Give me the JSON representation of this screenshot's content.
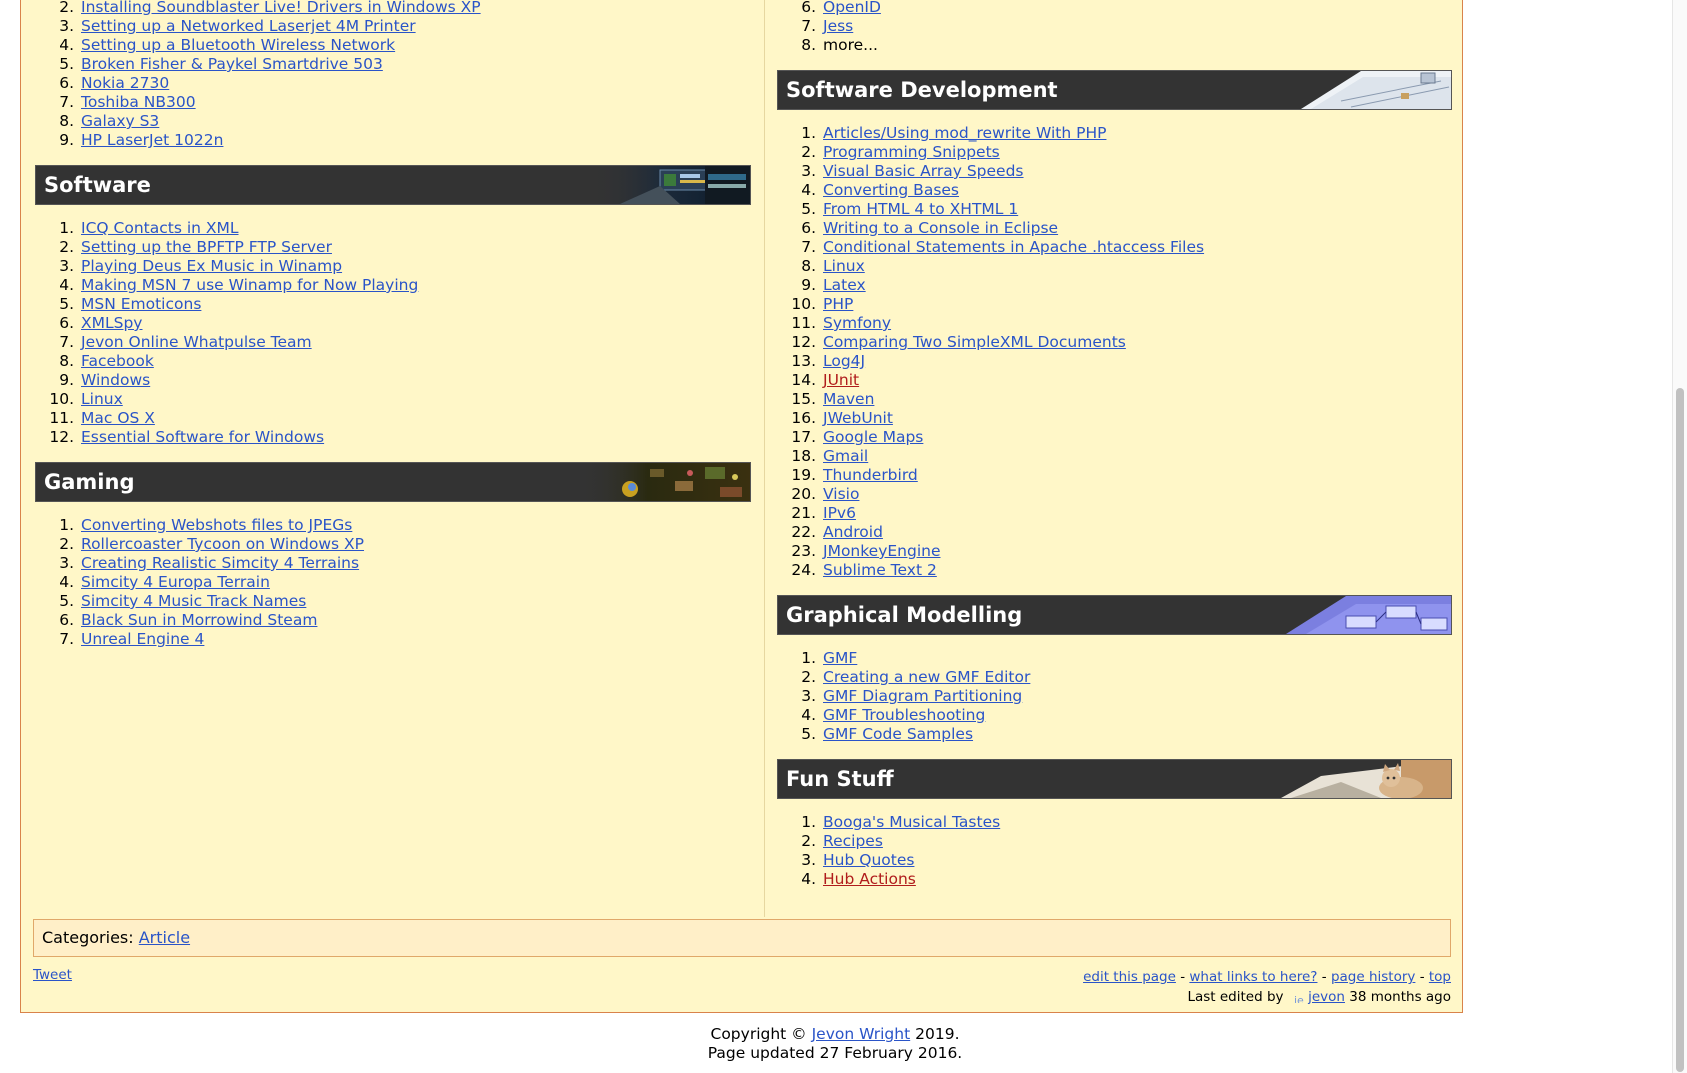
{
  "left": {
    "hardware_tail": {
      "start": 2,
      "items": [
        {
          "label": "Installing Soundblaster Live! Drivers in Windows XP"
        },
        {
          "label": "Setting up a Networked Laserjet 4M Printer"
        },
        {
          "label": "Setting up a Bluetooth Wireless Network"
        },
        {
          "label": "Broken Fisher & Paykel Smartdrive 503"
        },
        {
          "label": "Nokia 2730"
        },
        {
          "label": "Toshiba NB300"
        },
        {
          "label": "Galaxy S3"
        },
        {
          "label": "HP LaserJet 1022n"
        }
      ]
    },
    "software": {
      "title": "Software",
      "items": [
        {
          "label": "ICQ Contacts in XML"
        },
        {
          "label": "Setting up the BPFTP FTP Server"
        },
        {
          "label": "Playing Deus Ex Music in Winamp"
        },
        {
          "label": "Making MSN 7 use Winamp for Now Playing"
        },
        {
          "label": "MSN Emoticons"
        },
        {
          "label": "XMLSpy"
        },
        {
          "label": "Jevon Online Whatpulse Team"
        },
        {
          "label": "Facebook"
        },
        {
          "label": "Windows"
        },
        {
          "label": "Linux"
        },
        {
          "label": "Mac OS X"
        },
        {
          "label": "Essential Software for Windows"
        }
      ]
    },
    "gaming": {
      "title": "Gaming",
      "items": [
        {
          "label": "Converting Webshots files to JPEGs"
        },
        {
          "label": "Rollercoaster Tycoon on Windows XP"
        },
        {
          "label": "Creating Realistic Simcity 4 Terrains"
        },
        {
          "label": "Simcity 4 Europa Terrain"
        },
        {
          "label": "Simcity 4 Music Track Names"
        },
        {
          "label": "Black Sun in Morrowind Steam"
        },
        {
          "label": "Unreal Engine 4"
        }
      ]
    }
  },
  "right": {
    "prev_tail": {
      "start": 6,
      "items": [
        {
          "label": "OpenID",
          "link": true
        },
        {
          "label": "Jess",
          "link": true
        },
        {
          "label": "more...",
          "link": false
        }
      ]
    },
    "software_development": {
      "title": "Software Development",
      "items": [
        {
          "label": "Articles/Using mod_rewrite With PHP"
        },
        {
          "label": "Programming Snippets"
        },
        {
          "label": "Visual Basic Array Speeds"
        },
        {
          "label": "Converting Bases"
        },
        {
          "label": "From HTML 4 to XHTML 1"
        },
        {
          "label": "Writing to a Console in Eclipse"
        },
        {
          "label": "Conditional Statements in Apache .htaccess Files"
        },
        {
          "label": "Linux"
        },
        {
          "label": "Latex"
        },
        {
          "label": "PHP"
        },
        {
          "label": "Symfony"
        },
        {
          "label": "Comparing Two SimpleXML Documents"
        },
        {
          "label": "Log4J"
        },
        {
          "label": "JUnit",
          "missing": true
        },
        {
          "label": "Maven"
        },
        {
          "label": "JWebUnit"
        },
        {
          "label": "Google Maps"
        },
        {
          "label": "Gmail"
        },
        {
          "label": "Thunderbird"
        },
        {
          "label": "Visio"
        },
        {
          "label": "IPv6"
        },
        {
          "label": "Android"
        },
        {
          "label": "JMonkeyEngine"
        },
        {
          "label": "Sublime Text 2"
        }
      ]
    },
    "graphical_modelling": {
      "title": "Graphical Modelling",
      "items": [
        {
          "label": "GMF"
        },
        {
          "label": "Creating a new GMF Editor"
        },
        {
          "label": "GMF Diagram Partitioning"
        },
        {
          "label": "GMF Troubleshooting"
        },
        {
          "label": "GMF Code Samples"
        }
      ]
    },
    "fun_stuff": {
      "title": "Fun Stuff",
      "items": [
        {
          "label": "Booga's Musical Tastes"
        },
        {
          "label": "Recipes"
        },
        {
          "label": "Hub Quotes"
        },
        {
          "label": "Hub Actions",
          "missing": true
        }
      ]
    }
  },
  "categories": {
    "label": "Categories:",
    "link": "Article"
  },
  "footer": {
    "tweet": "Tweet",
    "links": [
      "edit this page",
      "what links to here?",
      "page history",
      "top"
    ],
    "separator": "-",
    "last_edited_prefix": "Last edited by",
    "avatar_text": "je",
    "editor": "jevon",
    "last_edited_suffix": "38 months ago"
  },
  "copyright": {
    "prefix": "Copyright ©",
    "author": "Jevon Wright",
    "year": "2019.",
    "updated": "Page updated 27 February 2016."
  },
  "colors": {
    "page_bg": "#fff7c8",
    "header_bg": "#333333",
    "link": "#2a54c8",
    "missing_link": "#b01c1c",
    "page_border": "#d9834a"
  }
}
